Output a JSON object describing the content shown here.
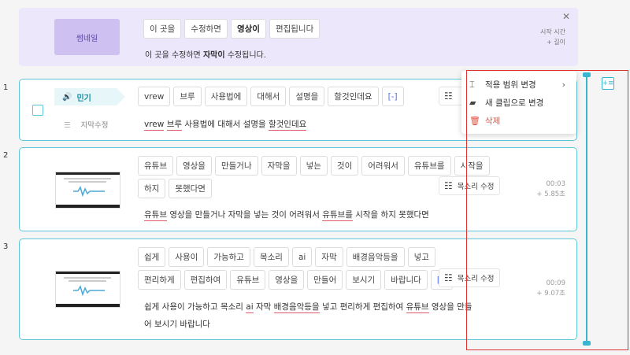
{
  "guide": {
    "thumb_label": "썸네일",
    "words": [
      "이 곳을",
      "수정하면",
      "영상이",
      "편집됩니다"
    ],
    "bold_word_index": 2,
    "sentence_parts": [
      "이 곳을 수정하면 ",
      "자막이",
      " 수정됩니다."
    ],
    "close": "✕",
    "meta_line1": "시작 시간",
    "meta_line2": "+ 길이"
  },
  "rows": [
    {
      "num": "1",
      "tag": "민기",
      "sub_edit": "자막수정",
      "words": [
        "vrew",
        "브루",
        "사용법에",
        "대해서",
        "설명을",
        "할것인데요",
        "[-]"
      ],
      "sentence": [
        "vrew",
        " ",
        "브루",
        " 사용법에 대해서 설명을 ",
        "할것인데요"
      ]
    },
    {
      "num": "2",
      "words": [
        "유튜브",
        "영상을",
        "만들거나",
        "자막을",
        "넣는",
        "것이",
        "어려워서",
        "유튜브를",
        "시작을",
        "하지",
        "못했다면"
      ],
      "voice_btn": "목소리 수정",
      "time": "00:03",
      "duration": "+ 5.85초",
      "sentence": [
        "유튜브",
        " 영상을 만들거나 자막을 넣는 것이 어려워서 ",
        "유튜브를",
        " 시작을 하지 못했다면"
      ]
    },
    {
      "num": "3",
      "words": [
        "쉽게",
        "사용이",
        "가능하고",
        "목소리",
        "ai",
        "자막",
        "배경음악등을",
        "넣고",
        "편리하게",
        "편집하여",
        "유튜브",
        "영상을",
        "만들어",
        "보시기",
        "바랍니다",
        "[-]"
      ],
      "voice_btn": "목소리 수정",
      "time": "00:09",
      "duration": "+ 9.07초",
      "sentence_line1": [
        "쉽게 사용이 가능하고 목소리 ",
        "ai",
        " 자막 ",
        "배경음악등을",
        " 넣고 편리하게 편집하여 ",
        "유튜브",
        " 영상을 만들"
      ],
      "sentence_line2": "어 보시기 바랍니다"
    }
  ],
  "context_menu": {
    "items": [
      {
        "label": "적용 범위 변경",
        "icon": "range-icon",
        "arrow": "›"
      },
      {
        "label": "새 클립으로 변경",
        "icon": "new-clip-icon"
      },
      {
        "label": "삭제",
        "icon": "trash-icon"
      }
    ]
  },
  "colors": {
    "accent": "#38b6d0",
    "guide_bg": "#ede7fb",
    "danger": "#e0533f",
    "underline": "#e05a6b",
    "highlight_box": "#dd3333"
  }
}
